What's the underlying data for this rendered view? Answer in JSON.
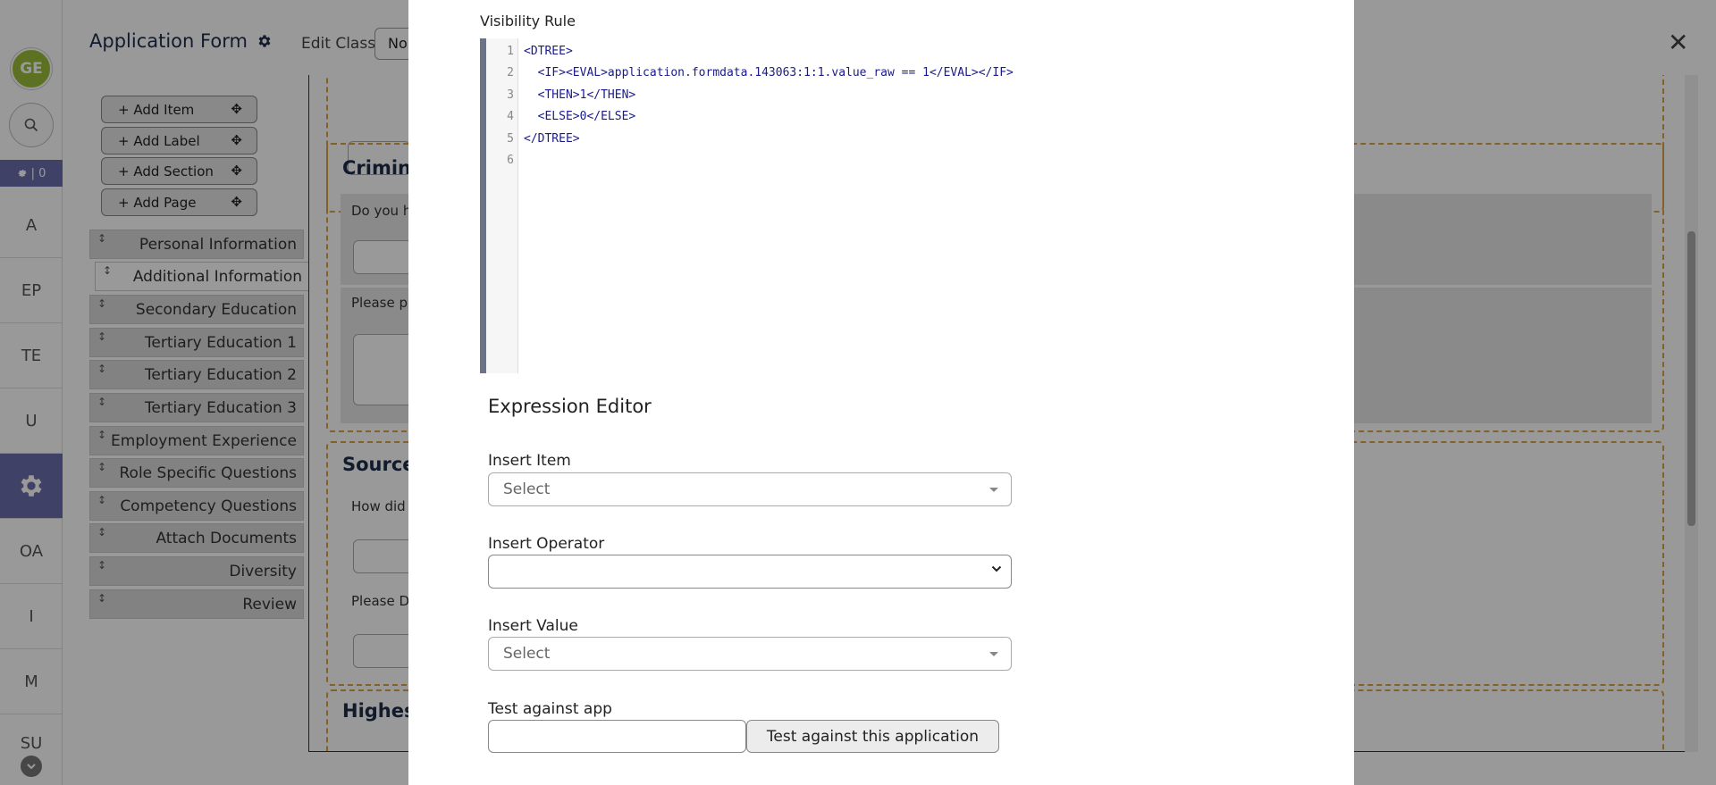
{
  "rail": {
    "avatar": "GE",
    "badge": "| 0",
    "items": [
      "A",
      "EP",
      "TE",
      "U",
      "",
      "OA",
      "I",
      "M",
      "SU"
    ]
  },
  "header": {
    "title": "Application Form",
    "edit_class_label": "Edit Class",
    "edit_class_value": "No"
  },
  "toolbar": {
    "add_item": "+ Add Item",
    "add_label": "+ Add Label",
    "add_section": "+ Add Section",
    "add_page": "+ Add Page"
  },
  "pages": [
    "Personal Information",
    "Additional Information",
    "Secondary Education",
    "Tertiary Education 1",
    "Tertiary Education 2",
    "Tertiary Education 3",
    "Employment Experience",
    "Role Specific Questions",
    "Competency Questions",
    "Attach Documents",
    "Diversity",
    "Review"
  ],
  "form": {
    "section_criminal": "Crimina",
    "criminal_q1": "Do you h",
    "criminal_q2": "Please p",
    "section_source": "Source",
    "source_q1": "How did",
    "source_q2": "Please D",
    "section_highest": "Highest"
  },
  "modal": {
    "visibility_label": "Visibility Rule",
    "code_lines": [
      "<DTREE>",
      "  <IF><EVAL>application.formdata.143063:1:1.value_raw == 1</EVAL></IF>",
      "  <THEN>1</THEN>",
      "  <ELSE>0</ELSE>",
      "</DTREE>",
      ""
    ],
    "line_numbers": [
      "1",
      "2",
      "3",
      "4",
      "5",
      "6"
    ],
    "expression_title": "Expression Editor",
    "insert_item_label": "Insert Item",
    "insert_item_placeholder": "Select",
    "insert_operator_label": "Insert Operator",
    "insert_value_label": "Insert Value",
    "insert_value_placeholder": "Select",
    "test_label": "Test against app",
    "test_button": "Test against this application"
  },
  "colors": {
    "accent": "#6a6daa",
    "avatar": "#9bbd3b",
    "section_border": "#d9a441"
  }
}
